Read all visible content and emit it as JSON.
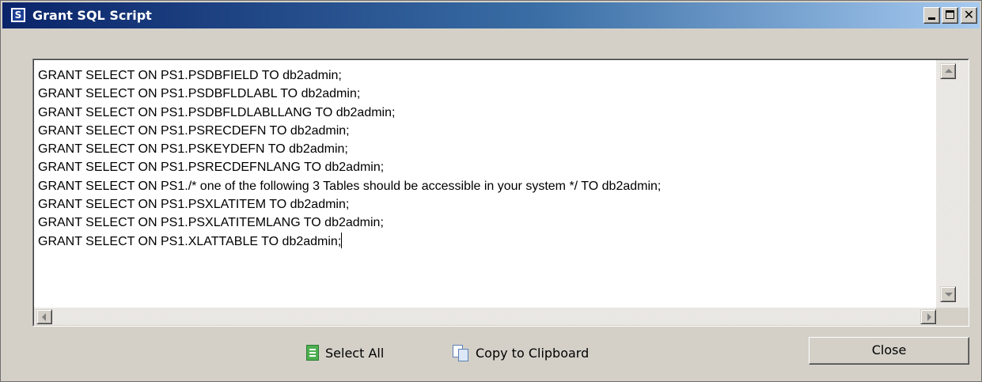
{
  "window": {
    "title": "Grant SQL Script",
    "icon": "app-s-icon",
    "icon_letter": "S",
    "controls": {
      "minimize": "minimize-icon",
      "maximize": "maximize-icon",
      "close": "close-icon",
      "close_glyph": "✕"
    }
  },
  "script": {
    "lines": [
      "GRANT SELECT ON PS1.PSDBFIELD TO db2admin;",
      "GRANT SELECT ON PS1.PSDBFLDLABL TO db2admin;",
      "GRANT SELECT ON PS1.PSDBFLDLABLLANG TO db2admin;",
      "GRANT SELECT ON PS1.PSRECDEFN TO db2admin;",
      "GRANT SELECT ON PS1.PSKEYDEFN TO db2admin;",
      "GRANT SELECT ON PS1.PSRECDEFNLANG TO db2admin;",
      "GRANT SELECT ON PS1./* one of the following 3 Tables should be accessible in your system */ TO db2admin;",
      "GRANT SELECT ON PS1.PSXLATITEM TO db2admin;",
      "GRANT SELECT ON PS1.PSXLATITEMLANG TO db2admin;",
      "GRANT SELECT ON PS1.XLATTABLE TO db2admin;"
    ]
  },
  "actions": {
    "select_all": {
      "label": "Select All",
      "icon": "document-icon"
    },
    "copy": {
      "label": "Copy to Clipboard",
      "icon": "copy-icon"
    },
    "close": {
      "label": "Close"
    }
  },
  "colors": {
    "titlebar_start": "#0a246a",
    "titlebar_end": "#a6caf0",
    "dialog_bg": "#d4d0c8"
  }
}
